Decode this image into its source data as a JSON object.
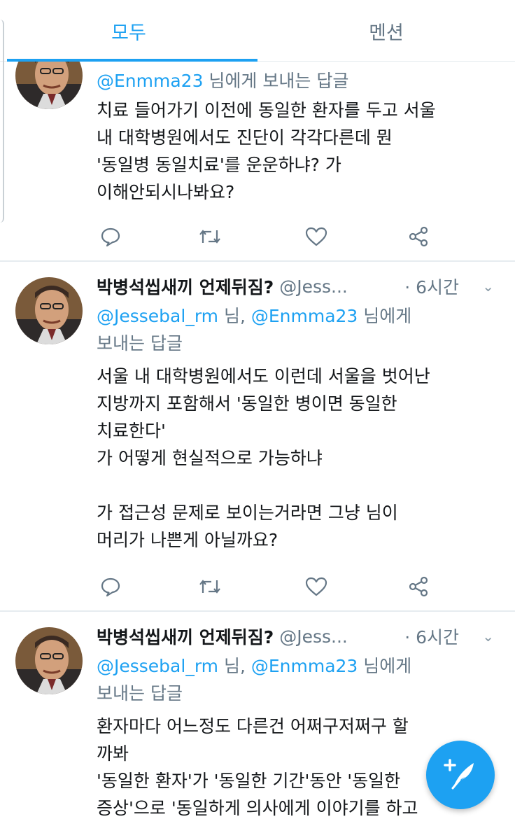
{
  "tabs": {
    "all": "모두",
    "mentions": "멘션"
  },
  "tweets": [
    {
      "reply_prefix": "",
      "reply_mentions": "@Enmma23",
      "reply_suffix": " 님에게 보내는 답글",
      "text": "치료 들어가기 이전에 동일한 환자를 두고 서울\n내 대학병원에서도 진단이 각각다른데 뭔\n'동일병 동일치료'를 운운하냐? 가\n이해안되시나봐요?"
    },
    {
      "name": "박병석씹새끼 언제뒤짐?",
      "handle": "@Jess...",
      "time": "· 6시간",
      "reply_mention1": "@Jessebal_rm",
      "reply_between": " 님, ",
      "reply_mention2": "@Enmma23",
      "reply_suffix": " 님에게",
      "reply_line2": "보내는 답글",
      "text": "서울 내 대학병원에서도 이런데 서울을 벗어난\n지방까지 포함해서 '동일한 병이면 동일한\n치료한다'\n가 어떻게 현실적으로 가능하냐\n\n가 접근성 문제로 보이는거라면 그냥 님이\n머리가 나쁜게 아닐까요?"
    },
    {
      "name": "박병석씹새끼 언제뒤짐?",
      "handle": "@Jess...",
      "time": "· 6시간",
      "reply_mention1": "@Jessebal_rm",
      "reply_between": " 님, ",
      "reply_mention2": "@Enmma23",
      "reply_suffix": " 님에게",
      "reply_line2": "보내는 답글",
      "text": "환자마다 어느정도 다른건 어쩌구저쩌구 할\n까봐\n'동일한 환자'가 '동일한 기간'동안 '동일한\n증상'으로 '동일하게 의사에게 이야기를 하고"
    }
  ],
  "icons": [
    "reply-icon",
    "retweet-icon",
    "like-icon",
    "share-icon",
    "compose-tweet-icon",
    "caret-down-icon"
  ],
  "colors": {
    "accent": "#1da1f2",
    "secondary_text": "#657786",
    "divider": "#e6ecf0"
  }
}
